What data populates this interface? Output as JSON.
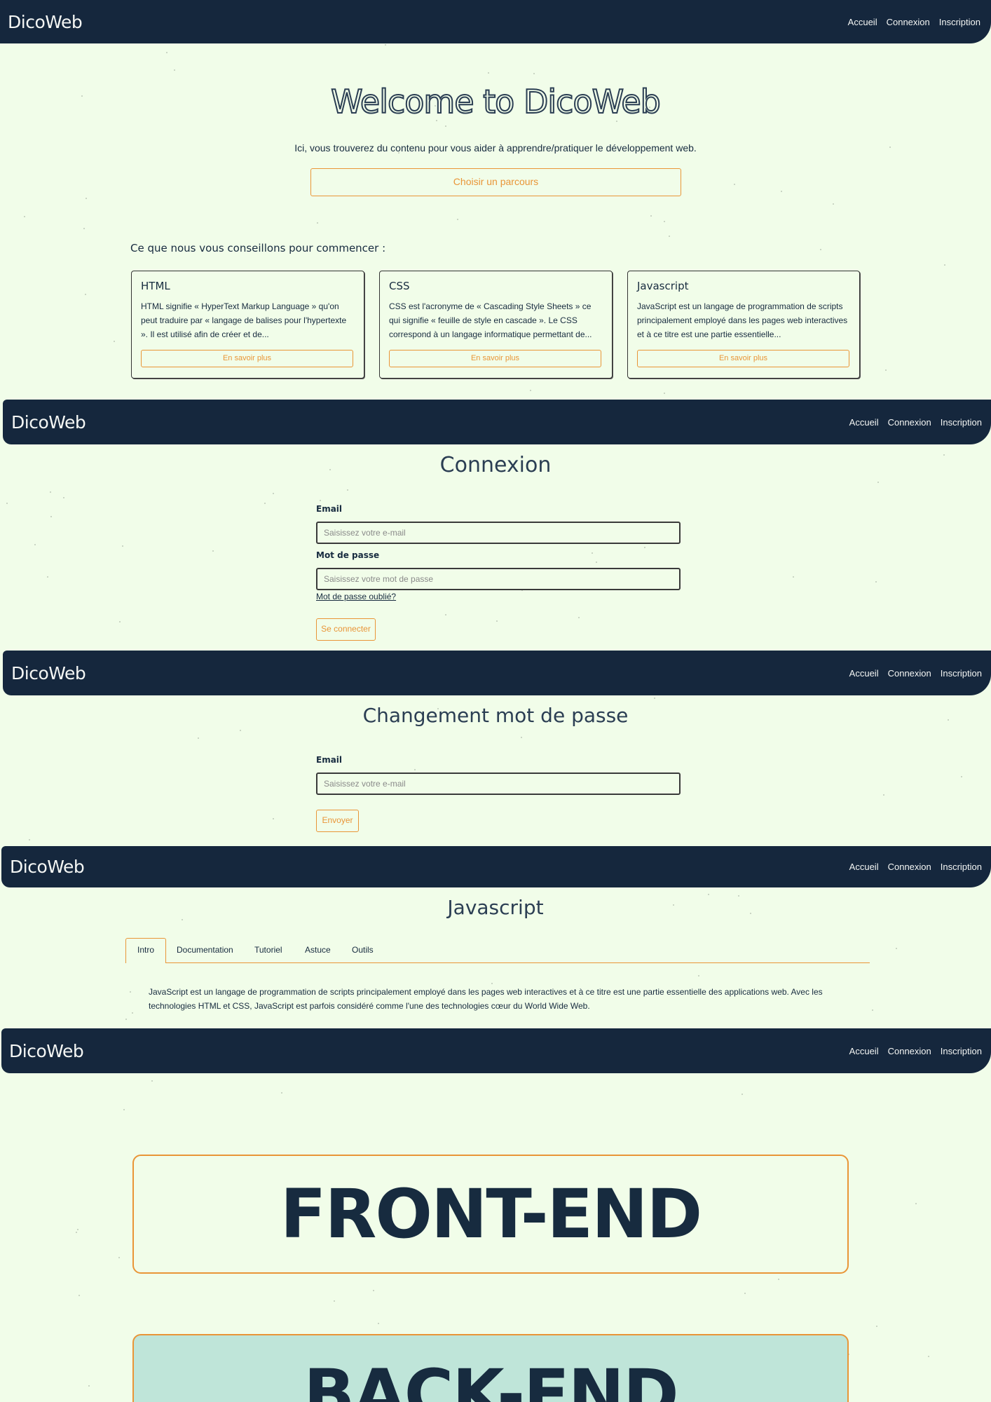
{
  "brand": "DicoWeb",
  "nav": {
    "home": "Accueil",
    "login": "Connexion",
    "signup": "Inscription"
  },
  "home": {
    "title": "Welcome to DicoWeb",
    "subtitle": "Ici, vous trouverez du contenu pour vous aider à apprendre/pratiquer le développement web.",
    "cta": "Choisir un parcours",
    "section_title": "Ce que nous vous conseillons pour commencer :",
    "cards": [
      {
        "title": "HTML",
        "text": "HTML signifie « HyperText Markup Language » qu'on peut traduire par « langage de balises pour l'hypertexte ». Il est utilisé afin de créer et de...",
        "button": "En savoir plus"
      },
      {
        "title": "CSS",
        "text": "CSS est l'acronyme de « Cascading Style Sheets » ce qui signifie « feuille de style en cascade ». Le CSS correspond à un langage informatique permettant de...",
        "button": "En savoir plus"
      },
      {
        "title": "Javascript",
        "text": "JavaScript est un langage de programmation de scripts principalement employé dans les pages web interactives et à ce titre est une partie essentielle...",
        "button": "En savoir plus"
      }
    ]
  },
  "login": {
    "title": "Connexion",
    "email_label": "Email",
    "email_placeholder": "Saisissez votre e-mail",
    "password_label": "Mot de passe",
    "password_placeholder": "Saisissez votre mot de passe",
    "forgot": "Mot de passe oublié?",
    "submit": "Se connecter"
  },
  "reset": {
    "title": "Changement mot de passe",
    "email_label": "Email",
    "email_placeholder": "Saisissez votre e-mail",
    "submit": "Envoyer"
  },
  "course": {
    "title": "Javascript",
    "tabs": [
      "Intro",
      "Documentation",
      "Tutoriel",
      "Astuce",
      "Outils"
    ],
    "active_tab": "Intro",
    "text": "JavaScript est un langage de programmation de scripts principalement employé dans les pages web interactives et à ce titre est une partie essentielle des applications web. Avec les technologies HTML et CSS, JavaScript est parfois considéré comme l'une des technologies cœur du World Wide Web."
  },
  "paths": {
    "front": "FRONT-END",
    "back": "BACK-END"
  },
  "colors": {
    "navy": "#15273d",
    "background": "#f1fde9",
    "accent": "#e99537",
    "back_end_fill": "#bfe5d9"
  }
}
